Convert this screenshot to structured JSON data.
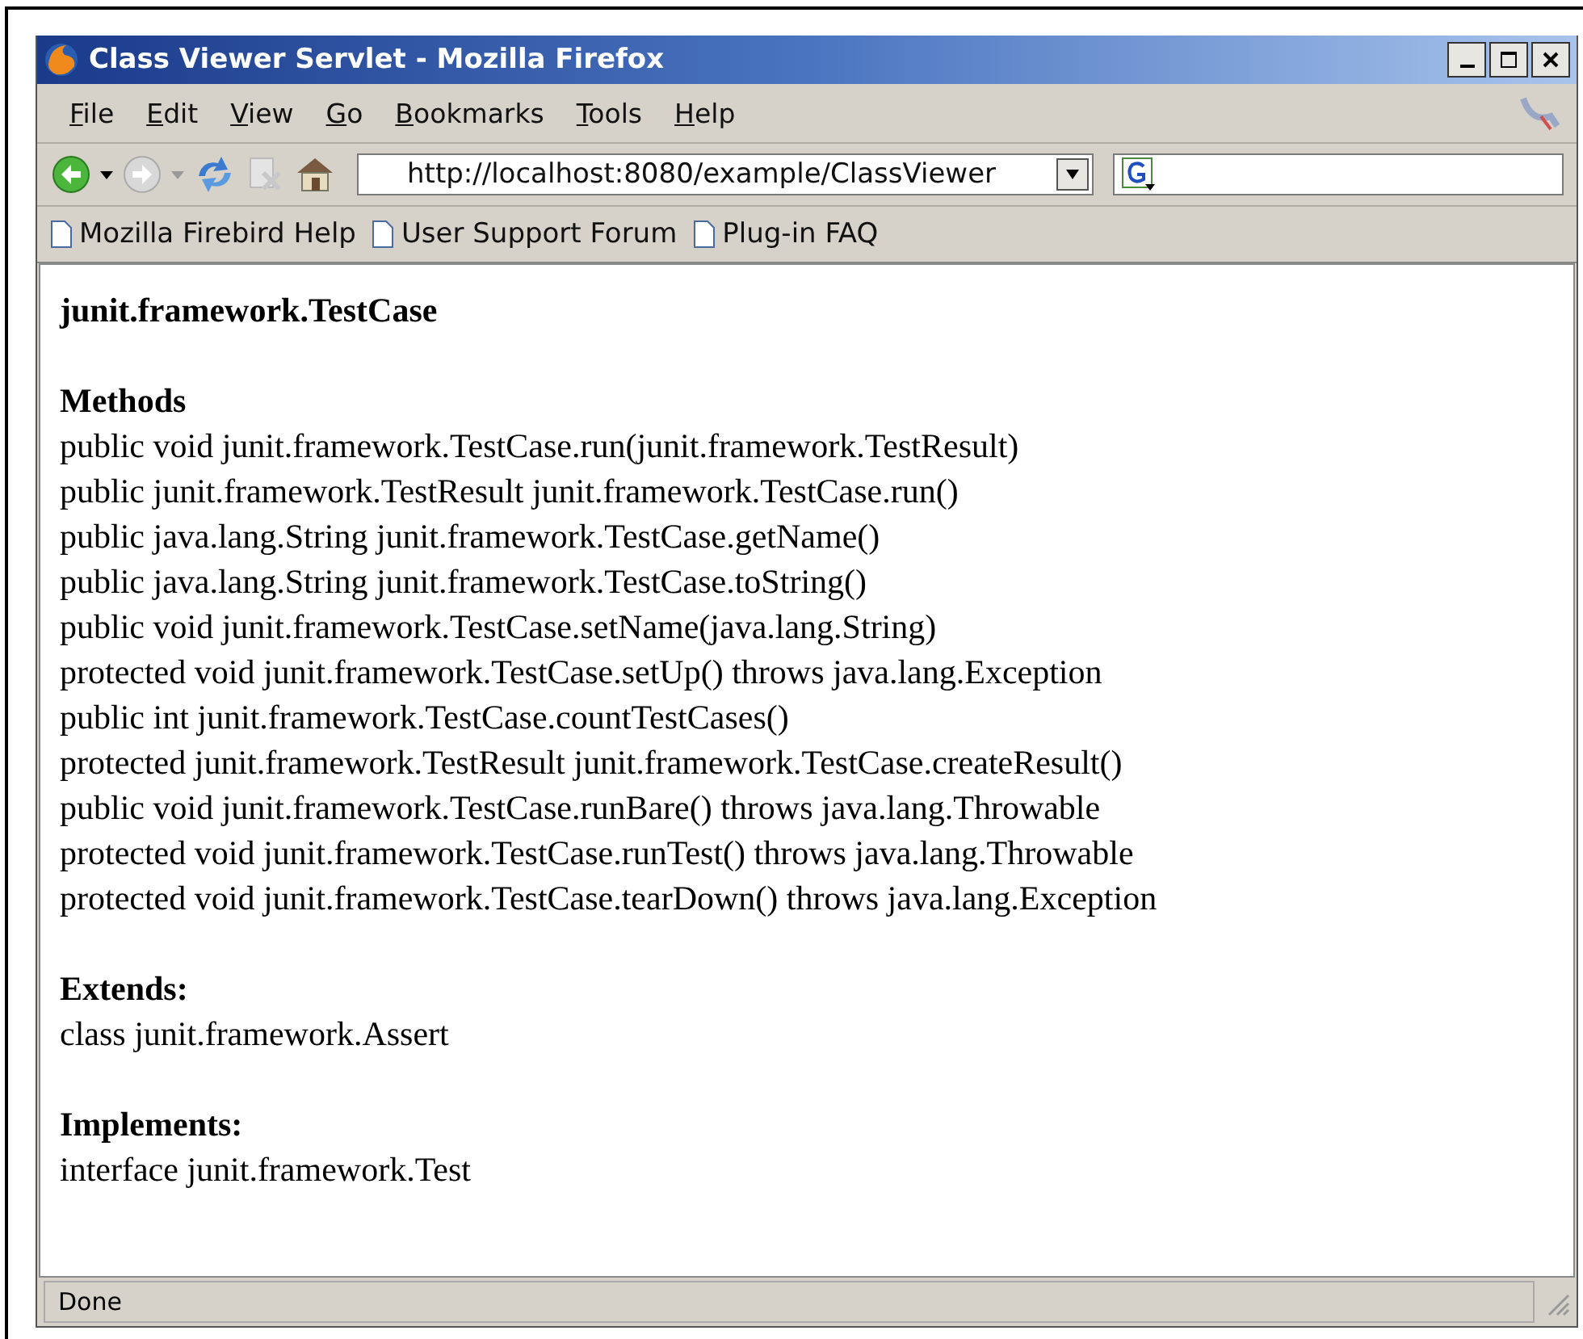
{
  "window": {
    "title": "Class Viewer Servlet - Mozilla Firefox"
  },
  "menu": [
    "File",
    "Edit",
    "View",
    "Go",
    "Bookmarks",
    "Tools",
    "Help"
  ],
  "address": {
    "value": "http://localhost:8080/example/ClassViewer"
  },
  "bookmarks": [
    "Mozilla Firebird Help",
    "User Support Forum",
    "Plug-in FAQ"
  ],
  "page": {
    "heading": "junit.framework.TestCase",
    "sections": [
      {
        "title": "Methods",
        "lines": [
          "public void junit.framework.TestCase.run(junit.framework.TestResult)",
          "public junit.framework.TestResult junit.framework.TestCase.run()",
          "public java.lang.String junit.framework.TestCase.getName()",
          "public java.lang.String junit.framework.TestCase.toString()",
          "public void junit.framework.TestCase.setName(java.lang.String)",
          "protected void junit.framework.TestCase.setUp() throws java.lang.Exception",
          "public int junit.framework.TestCase.countTestCases()",
          "protected junit.framework.TestResult junit.framework.TestCase.createResult()",
          "public void junit.framework.TestCase.runBare() throws java.lang.Throwable",
          "protected void junit.framework.TestCase.runTest() throws java.lang.Throwable",
          "protected void junit.framework.TestCase.tearDown() throws java.lang.Exception"
        ]
      },
      {
        "title": "Extends:",
        "lines": [
          "class junit.framework.Assert"
        ]
      },
      {
        "title": "Implements:",
        "lines": [
          "interface junit.framework.Test"
        ]
      }
    ]
  },
  "status_bar": {
    "text": "Done"
  }
}
